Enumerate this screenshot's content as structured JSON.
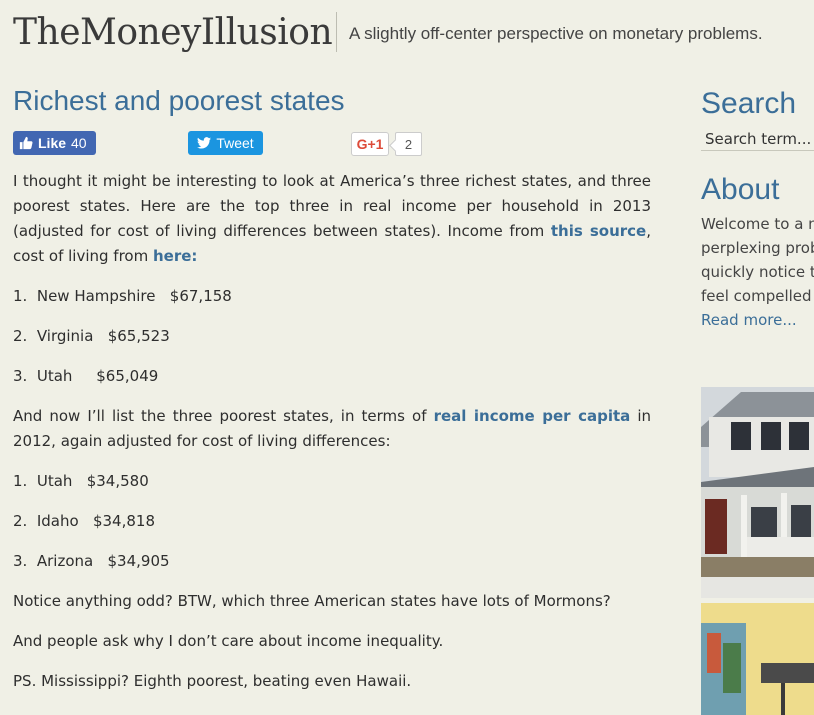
{
  "site": {
    "title": "TheMoneyIllusion",
    "tagline": "A slightly off-center perspective on monetary problems."
  },
  "post": {
    "title": "Richest and poorest states",
    "social": {
      "like_label": "Like",
      "like_count": "40",
      "tweet_label": "Tweet",
      "gplus_label": "G+1",
      "gplus_count": "2"
    },
    "intro_text": "I thought it might be interesting to look at America’s three richest states, and three poorest states.  Here are the top three in real income per household in 2013 (adjusted for cost of living differences between states).  Income from ",
    "intro_link1": "this source",
    "intro_text2": ", cost of living from ",
    "intro_link2": "here",
    "intro_text3": ":",
    "richest": [
      "1.  New Hampshire   $67,158",
      "2.  Virginia   $65,523",
      "3.  Utah     $65,049"
    ],
    "poor_intro_text": "And now I’ll list the three poorest states, in terms of ",
    "poor_intro_link": "real income per capita",
    "poor_intro_text2": " in 2012, again adjusted for cost of living differences:",
    "poorest": [
      "1.  Utah   $34,580",
      "2.  Idaho   $34,818",
      "3.  Arizona   $34,905"
    ],
    "para_odd": "Notice anything odd?  BTW, which three American states have lots of Mormons?",
    "para_inequality": "And people ask why I don’t care about income inequality.",
    "para_ps": "PS.  Mississippi?  Eighth poorest, beating even Hawaii."
  },
  "sidebar": {
    "search_title": "Search",
    "search_placeholder": "Search term...",
    "about_title": "About",
    "about_lines": [
      "Welcome to a n",
      "perplexing prob",
      "quickly notice t",
      "feel compelled"
    ],
    "read_more": "Read more..."
  },
  "colors": {
    "background": "#f0f0e6",
    "link": "#3b6e98",
    "facebook": "#4267b2",
    "twitter": "#1b95e0",
    "gplus": "#dd4b39"
  }
}
